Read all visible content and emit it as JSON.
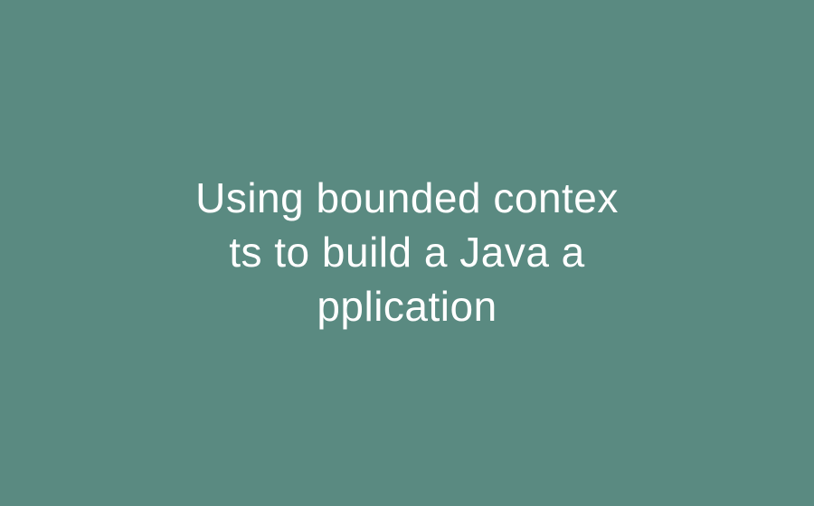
{
  "text": {
    "line1": "Using bounded contex",
    "line2": "ts to build a Java a",
    "line3": "pplication"
  },
  "colors": {
    "background": "#5a8a81",
    "text": "#ffffff"
  }
}
